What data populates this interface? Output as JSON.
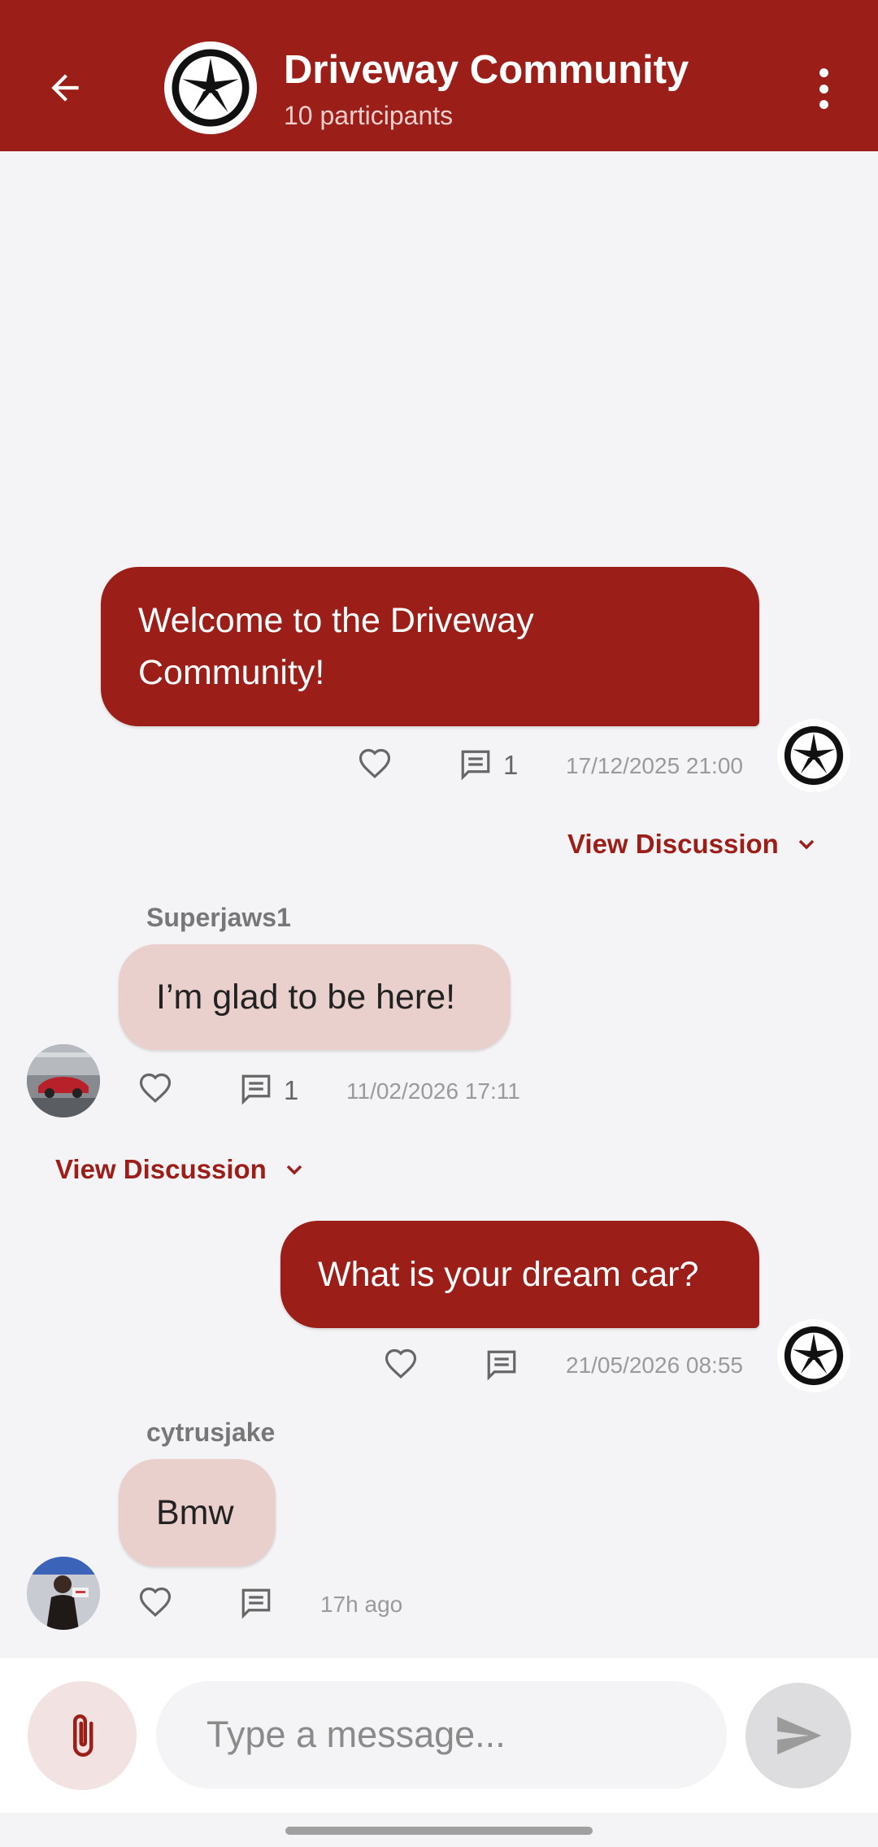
{
  "header": {
    "title": "Driveway Community",
    "subtitle": "10 participants",
    "back_icon": "arrow-left-icon",
    "more_icon": "more-vertical-icon",
    "color": "#9c1e18"
  },
  "messages": [
    {
      "id": "msg1",
      "direction": "outgoing",
      "lines": [
        "Welcome to the Driveway",
        "Community!"
      ],
      "comment_count": "1",
      "timestamp": "17/12/2025 21:00",
      "view_discussion": "View Discussion"
    },
    {
      "id": "msg2",
      "direction": "incoming",
      "sender": "Superjaws1",
      "text": "I’m glad to be here!",
      "comment_count": "1",
      "timestamp": "11/02/2026 17:11",
      "view_discussion": "View Discussion"
    },
    {
      "id": "msg3",
      "direction": "outgoing",
      "text": "What is your dream car?",
      "timestamp": "21/05/2026 08:55"
    },
    {
      "id": "msg4",
      "direction": "incoming",
      "sender": "cytrusjake",
      "text": "Bmw",
      "timestamp": "17h ago"
    }
  ],
  "composer": {
    "placeholder": "Type a message...",
    "attach_icon": "paperclip-icon",
    "send_icon": "send-icon"
  },
  "colors": {
    "brand": "#9c1e18",
    "incoming_bubble": "#ead0cc",
    "background": "#f4f3f5"
  }
}
